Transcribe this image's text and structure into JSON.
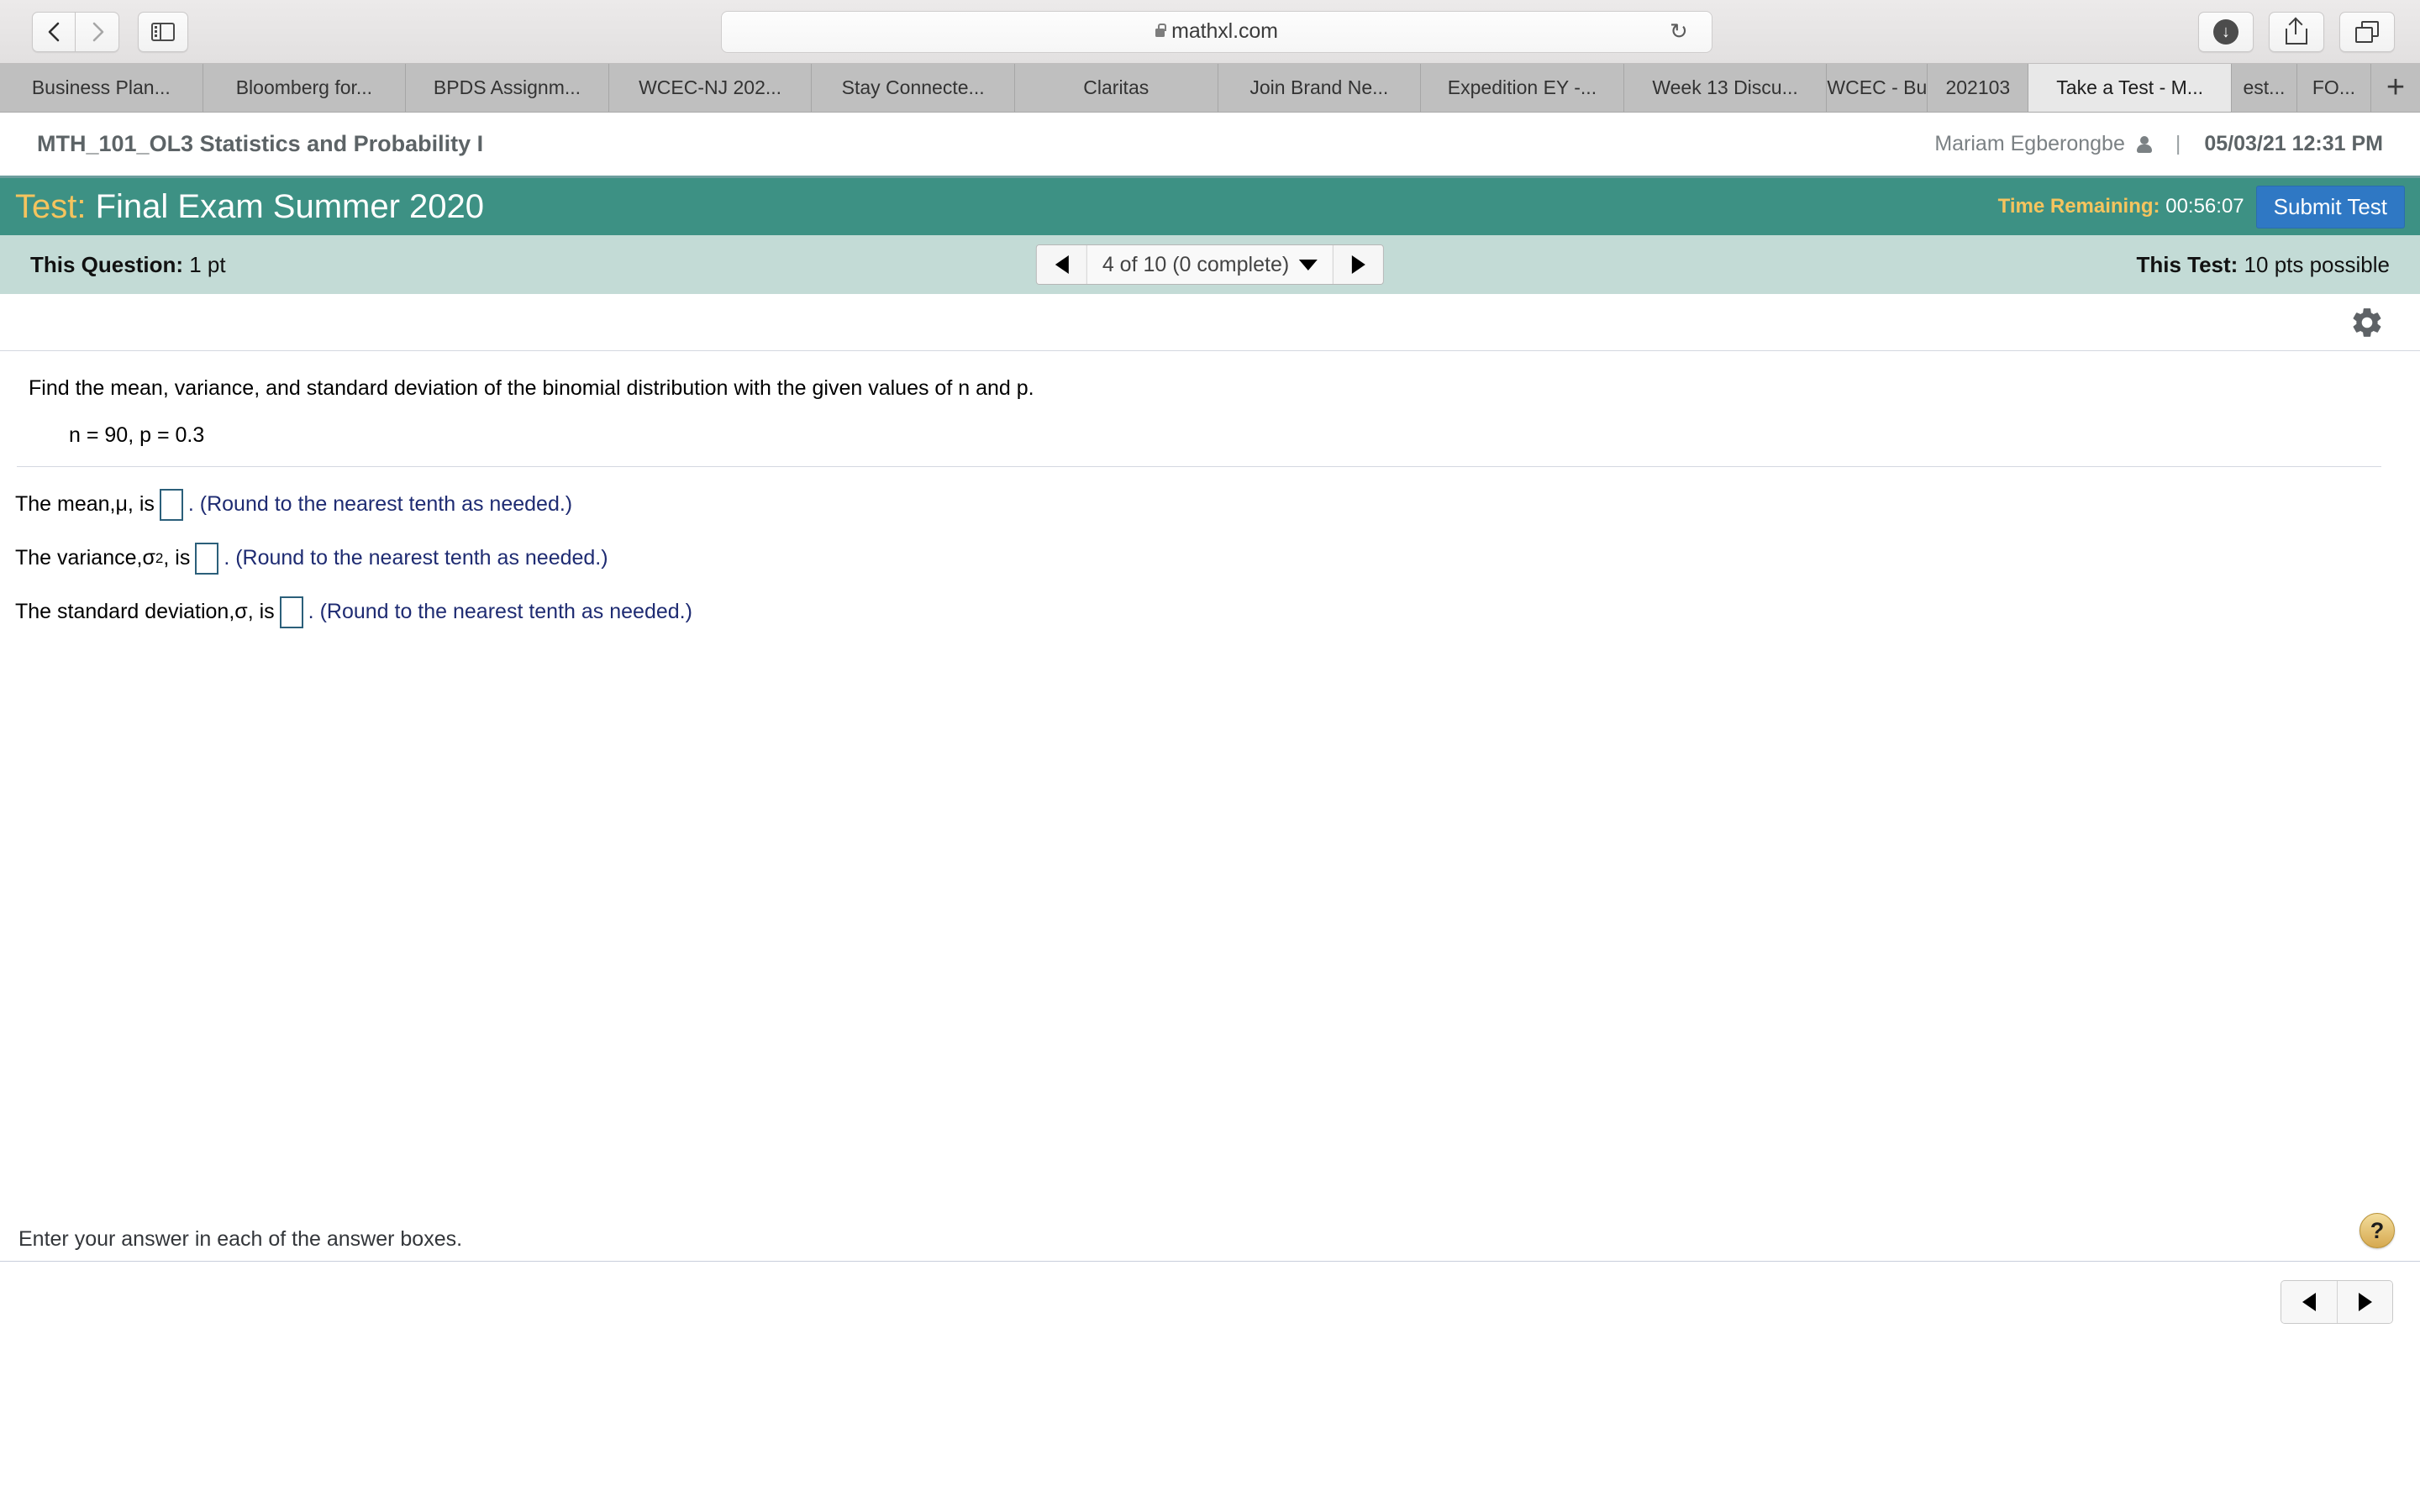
{
  "browser": {
    "url": "mathxl.com",
    "back_icon": "chevron-left-icon",
    "forward_icon": "chevron-right-icon",
    "sidebar_icon": "sidebar-toggle-icon",
    "lock_icon": "lock-icon",
    "reload_icon": "reload-icon",
    "download_icon": "download-icon",
    "share_icon": "share-icon",
    "tabs_overview_icon": "tab-overview-icon",
    "new_tab_label": "+",
    "tabs": [
      {
        "label": "Business Plan...",
        "active": false
      },
      {
        "label": "Bloomberg for...",
        "active": false
      },
      {
        "label": "BPDS Assignm...",
        "active": false
      },
      {
        "label": "WCEC-NJ 202...",
        "active": false
      },
      {
        "label": "Stay Connecte...",
        "active": false
      },
      {
        "label": "Claritas",
        "active": false
      },
      {
        "label": "Join Brand Ne...",
        "active": false
      },
      {
        "label": "Expedition EY -...",
        "active": false
      },
      {
        "label": "Week 13 Discu...",
        "active": false
      },
      {
        "label": "WCEC - Bu",
        "active": false
      },
      {
        "label": "202103",
        "active": false
      },
      {
        "label": "Take a Test - M...",
        "active": true
      },
      {
        "label": "est...",
        "active": false
      },
      {
        "label": "FO...",
        "active": false
      }
    ]
  },
  "header": {
    "course_title": "MTH_101_OL3 Statistics and Probability I",
    "user_name": "Mariam Egberongbe",
    "person_icon": "person-icon",
    "separator": "|",
    "timestamp": "05/03/21 12:31 PM"
  },
  "test_bar": {
    "keyword": "Test:",
    "title": "Final Exam Summer 2020",
    "time_label": "Time Remaining:",
    "time_value": "00:56:07",
    "submit_label": "Submit Test",
    "bar_color": "#3d9184",
    "accent_color": "#f5c45e",
    "submit_color": "#2f78c4"
  },
  "subnav": {
    "question_points_label": "This Question:",
    "question_points_value": "1 pt",
    "prev_icon": "triangle-left-icon",
    "next_icon": "triangle-right-icon",
    "dropdown_icon": "triangle-down-icon",
    "pager_label": "4 of 10 (0 complete)",
    "test_points_label": "This Test:",
    "test_points_value": "10 pts possible",
    "bar_color": "#c3dbd6"
  },
  "toolbar": {
    "settings_icon": "gear-icon"
  },
  "question": {
    "prompt": "Find the mean, variance, and standard deviation of the binomial distribution with the given values of n and p.",
    "given": "n = 90, p = 0.3",
    "answers": [
      {
        "lead_pre": "The mean, ",
        "symbol": "μ",
        "symbol_sup": "",
        "lead_post": ", is",
        "value": "",
        "hint": ". (Round to the nearest tenth as needed.)"
      },
      {
        "lead_pre": "The variance, ",
        "symbol": "σ",
        "symbol_sup": "2",
        "lead_post": ", is",
        "value": "",
        "hint": ". (Round to the nearest tenth as needed.)"
      },
      {
        "lead_pre": "The standard deviation, ",
        "symbol": "σ",
        "symbol_sup": "",
        "lead_post": ", is",
        "value": "",
        "hint": ". (Round to the nearest tenth as needed.)"
      }
    ]
  },
  "footer": {
    "instruction": "Enter your answer in each of the answer boxes.",
    "help_label": "?",
    "help_icon": "help-question-icon",
    "prev_icon": "triangle-left-icon",
    "next_icon": "triangle-right-icon"
  }
}
